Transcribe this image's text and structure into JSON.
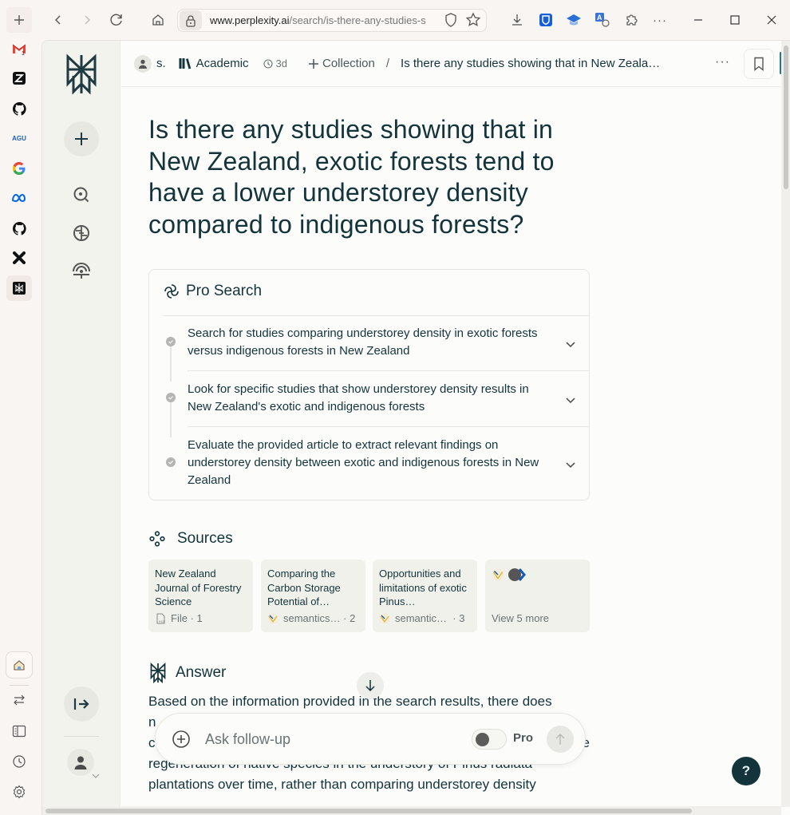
{
  "browser": {
    "url_domain": "www.perplexity.ai",
    "url_path": "/search/is-there-any-studies-s",
    "buttons": {
      "new_tab": "+",
      "back": "back",
      "forward": "forward",
      "reload": "reload",
      "home": "home",
      "more": "···"
    },
    "sidebar_sites": [
      "Gmail",
      "Zotero",
      "GitHub",
      "AGU",
      "Google",
      "Meta",
      "GitHub",
      "X",
      "Perplexity"
    ],
    "gmail_badge": "1",
    "agu_label": "AGU"
  },
  "sidebar": {
    "items": [
      {
        "label": "New Thread"
      },
      {
        "label": "Discover"
      },
      {
        "label": "Spaces"
      },
      {
        "label": "Library"
      }
    ],
    "collapse_label": "Expand sidebar",
    "account_label": "Account"
  },
  "header": {
    "user": "s.",
    "focus": "Academic",
    "age": "3d",
    "collection": "Collection",
    "separator": "/",
    "thread_title": "Is there any studies showing that in New Zeala…",
    "more": "···"
  },
  "main": {
    "question": "Is there any studies showing that in New Zealand, exotic forests tend to have a lower understorey density compared to indigenous forests?",
    "pro_search": {
      "title": "Pro Search",
      "steps": [
        {
          "text": "Search for studies comparing understorey density in exotic forests versus indigenous forests in New Zealand"
        },
        {
          "text": "Look for specific studies that show understorey density results in New Zealand's exotic and indigenous forests"
        },
        {
          "text": "Evaluate the provided article to extract relevant findings on understorey density between exotic and indigenous forests in New Zealand"
        }
      ]
    },
    "sources": {
      "title": "Sources",
      "cards": [
        {
          "title": "New Zealand Journal of Forestry Science",
          "source": "File",
          "index": "· 1"
        },
        {
          "title": "Comparing the Carbon Storage Potential of…",
          "source": "semantics…",
          "index": "· 2"
        },
        {
          "title": "Opportunities and limitations of exotic Pinus…",
          "source": "semantic…",
          "index": "· 3"
        }
      ],
      "view_more": "View 5 more"
    },
    "answer": {
      "title": "Answer",
      "line1": "Based on the information provided in the search results, there does",
      "line2": "n",
      "line3": "co",
      "line3_end": "the",
      "line4": "regeneration of native species in the understory of Pinus radiata",
      "line5": "plantations over time, rather than comparing understorey density"
    },
    "followup": {
      "placeholder": "Ask follow-up",
      "pro_label": "Pro",
      "pro_enabled": false
    },
    "help_label": "?"
  }
}
